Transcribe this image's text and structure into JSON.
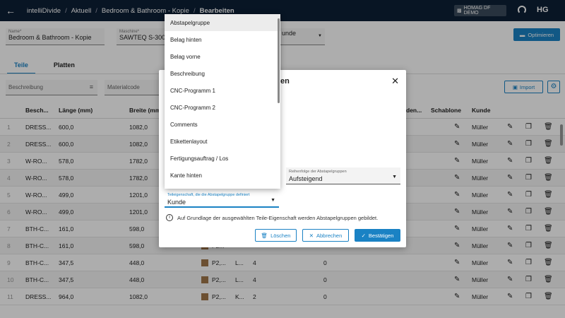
{
  "topbar": {
    "app": "intelliDivide",
    "crumbs": [
      "Aktuell",
      "Bedroom & Bathroom - Kopie"
    ],
    "current": "Bearbeiten",
    "demo_badge": "HOMAG DF DEMO",
    "logo": "HG"
  },
  "header": {
    "name_label": "Name*",
    "name_value": "Bedroom & Bathroom - Kopie",
    "machine_label": "Maschine*",
    "machine_value": "SAWTEQ S-300, S",
    "third_value": "unde",
    "optimize_label": "Optimieren"
  },
  "tabs": [
    "Teile",
    "Platten"
  ],
  "filters": {
    "description": "Beschreibung",
    "material": "Materialcode",
    "import_label": "Import"
  },
  "table": {
    "headers": [
      "Besch...",
      "Länge (mm)",
      "Breite (mm",
      "den...",
      "Schablone",
      "Kunde"
    ],
    "rows": [
      {
        "idx": "1",
        "name": "DRESS...",
        "len": "600,0",
        "wid": "1082,0",
        "c1": "",
        "c2": "",
        "c3": "",
        "c4": "",
        "kunde": "Müller"
      },
      {
        "idx": "2",
        "name": "DRESS...",
        "len": "600,0",
        "wid": "1082,0",
        "c1": "",
        "c2": "",
        "c3": "",
        "c4": "",
        "kunde": "Müller"
      },
      {
        "idx": "3",
        "name": "W-RO...",
        "len": "578,0",
        "wid": "1782,0",
        "c1": "",
        "c2": "",
        "c3": "",
        "c4": "",
        "kunde": "Müller"
      },
      {
        "idx": "4",
        "name": "W-RO...",
        "len": "578,0",
        "wid": "1782,0",
        "c1": "",
        "c2": "",
        "c3": "",
        "c4": "",
        "kunde": "Müller"
      },
      {
        "idx": "5",
        "name": "W-RO...",
        "len": "499,0",
        "wid": "1201,0",
        "c1": "",
        "c2": "",
        "c3": "",
        "c4": "",
        "kunde": "Müller"
      },
      {
        "idx": "6",
        "name": "W-RO...",
        "len": "499,0",
        "wid": "1201,0",
        "c1": "",
        "c2": "",
        "c3": "",
        "c4": "",
        "kunde": "Müller"
      },
      {
        "idx": "7",
        "name": "BTH-C...",
        "len": "161,0",
        "wid": "598,0",
        "c1": "P2...",
        "c2": "",
        "c3": "",
        "c4": "",
        "kunde": "Müller"
      },
      {
        "idx": "8",
        "name": "BTH-C...",
        "len": "161,0",
        "wid": "598,0",
        "c1": "P2...",
        "c2": "",
        "c3": "",
        "c4": "",
        "kunde": "Müller"
      },
      {
        "idx": "9",
        "name": "BTH-C...",
        "len": "347,5",
        "wid": "448,0",
        "c1": "P2,...",
        "c2": "L...",
        "c3": "4",
        "c4": "0",
        "kunde": "Müller"
      },
      {
        "idx": "10",
        "name": "BTH-C...",
        "len": "347,5",
        "wid": "448,0",
        "c1": "P2,...",
        "c2": "L...",
        "c3": "4",
        "c4": "0",
        "kunde": "Müller"
      },
      {
        "idx": "11",
        "name": "DRESS...",
        "len": "964,0",
        "wid": "1082,0",
        "c1": "P2,...",
        "c2": "K...",
        "c3": "2",
        "c4": "0",
        "kunde": "Müller"
      }
    ]
  },
  "modal": {
    "title": "Abstapelgruppen",
    "title_visible": "en",
    "order_label": "Reihenfolge der Abstapelgruppen",
    "order_value": "Aufsteigend",
    "prop_label": "Teileigenschaft, die die Abstapelgruppe definiert",
    "prop_value": "Kunde",
    "info": "Auf Grundlage der ausgewählten Teile-Eigenschaft werden Abstapelgruppen gebildet.",
    "delete_label": "Löschen",
    "cancel_label": "Abbrechen",
    "confirm_label": "Bestätigen"
  },
  "dropdown": {
    "items": [
      "Abstapelgruppe",
      "Belag hinten",
      "Belag vorne",
      "Beschreibung",
      "CNC-Programm 1",
      "CNC-Programm 2",
      "Comments",
      "Etikettenlayout",
      "Fertigungsauftrag / Los",
      "Kante hinten"
    ]
  },
  "colors": {
    "accent": "#1a82c4",
    "topbar": "#0d1f35"
  }
}
